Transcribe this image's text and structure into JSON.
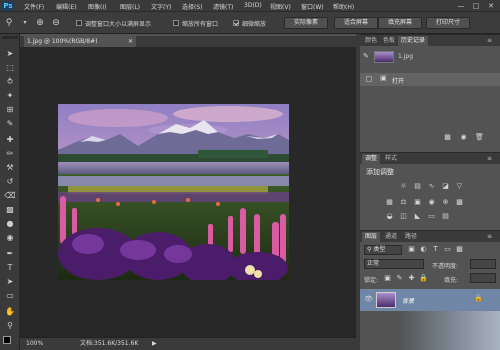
{
  "app": {
    "logo": "Ps"
  },
  "menu": [
    "文件(F)",
    "编辑(E)",
    "图像(I)",
    "图层(L)",
    "文字(Y)",
    "选择(S)",
    "滤镜(T)",
    "3D(D)",
    "视图(V)",
    "窗口(W)",
    "帮助(H)"
  ],
  "window_controls": {
    "minimize": "—",
    "restore": "□",
    "close": "✕"
  },
  "options": {
    "resize_windows_label": "调整窗口大小以满屏显示",
    "zoom_all_label": "缩放所有窗口",
    "scrubby_zoom_label": "细微缩放",
    "actual_pixels": "实际像素",
    "fit_screen": "适合屏幕",
    "fill_screen": "填充屏幕",
    "print_size": "打印尺寸",
    "resize_windows_checked": false,
    "zoom_all_checked": false,
    "scrubby_zoom_checked": true
  },
  "document": {
    "tab_title": "1.jpg @ 100%(RGB/8#)",
    "zoom": "100%",
    "doc_info": "文档:351.6K/351.6K"
  },
  "history_panel": {
    "tabs": [
      "颜色",
      "色板",
      "历史记录"
    ],
    "active_tab": 2,
    "snapshot_label": "1.jpg",
    "entries": [
      "打开"
    ]
  },
  "adjustments_panel": {
    "tabs": [
      "调整",
      "样式"
    ],
    "title": "添加调整"
  },
  "layers_panel": {
    "tabs": [
      "图层",
      "通道",
      "路径"
    ],
    "filter_label": "类型",
    "blend_mode": "正常",
    "opacity_label": "不透明度:",
    "lock_label": "锁定:",
    "fill_label": "填充:",
    "layer_name": "背景"
  }
}
